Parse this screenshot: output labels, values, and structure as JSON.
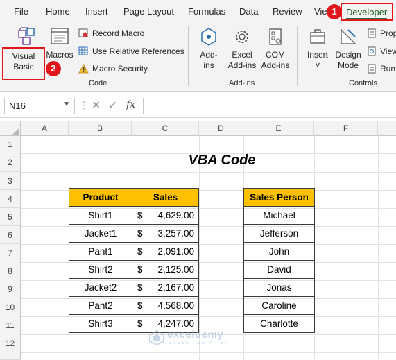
{
  "menu": {
    "items": [
      "File",
      "Home",
      "Insert",
      "Page Layout",
      "Formulas",
      "Data",
      "Review",
      "Vie"
    ],
    "active": "Developer"
  },
  "callouts": [
    "1",
    "2"
  ],
  "ribbon": {
    "code": {
      "visual_basic": [
        "Visual",
        "Basic"
      ],
      "macros": "Macros",
      "record_macro": "Record Macro",
      "relative_refs": "Use Relative References",
      "macro_security": "Macro Security",
      "label": "Code"
    },
    "addins": {
      "addins": [
        "Add-",
        "ins"
      ],
      "excel_addins": [
        "Excel",
        "Add-ins"
      ],
      "com_addins": [
        "COM",
        "Add-ins"
      ],
      "label": "Add-ins"
    },
    "controls": {
      "insert": "Insert",
      "insert_chevron": "˅",
      "design_mode": [
        "Design",
        "Mode"
      ],
      "properties": "Prop",
      "view_code": "View",
      "run_dialog": "Run",
      "label": "Controls"
    }
  },
  "formula_bar": {
    "name_box": "N16",
    "formula": ""
  },
  "columns": [
    "A",
    "B",
    "C",
    "D",
    "E",
    "F"
  ],
  "rows": [
    "1",
    "2",
    "3",
    "4",
    "5",
    "6",
    "7",
    "8",
    "9",
    "10",
    "11",
    "12"
  ],
  "sheet": {
    "title": "VBA Code",
    "sales_table": {
      "headers": [
        "Product",
        "Sales"
      ],
      "rows": [
        {
          "product": "Shirt1",
          "sales": "4,629.00"
        },
        {
          "product": "Jacket1",
          "sales": "3,257.00"
        },
        {
          "product": "Pant1",
          "sales": "2,091.00"
        },
        {
          "product": "Shirt2",
          "sales": "2,125.00"
        },
        {
          "product": "Jacket2",
          "sales": "2,167.00"
        },
        {
          "product": "Pant2",
          "sales": "4,568.00"
        },
        {
          "product": "Shirt3",
          "sales": "4,247.00"
        }
      ],
      "currency_symbol": "$"
    },
    "person_table": {
      "header": "Sales Person",
      "rows": [
        "Michael",
        "Jefferson",
        "John",
        "David",
        "Jonas",
        "Caroline",
        "Charlotte"
      ]
    }
  },
  "watermark": {
    "name": "exceldemy",
    "sub": "EXCEL · DATA · BI"
  },
  "colors": {
    "header_fill": "#ffc000",
    "callout": "#e0161b",
    "accent": "#217346"
  }
}
